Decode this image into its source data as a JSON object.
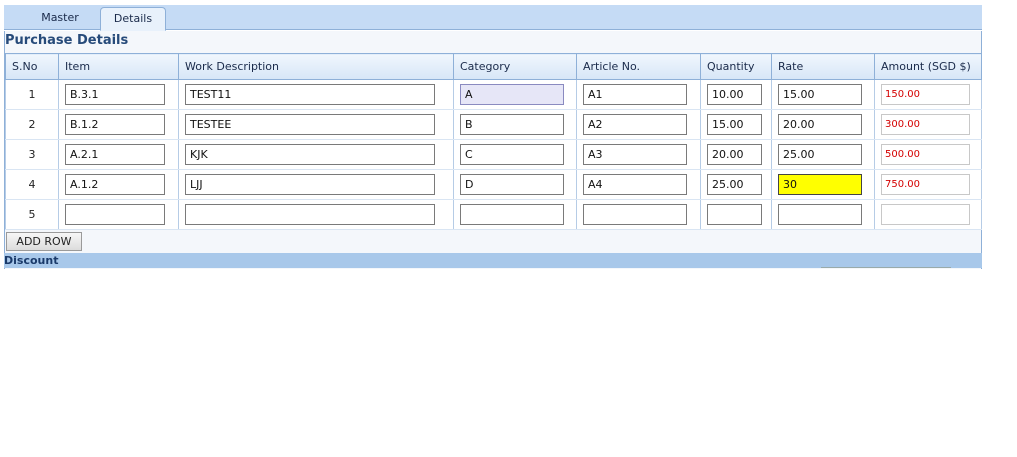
{
  "tabs": [
    {
      "label": "Master"
    },
    {
      "label": "Details"
    }
  ],
  "panel": {
    "title": "Purchase Details"
  },
  "table": {
    "columns": [
      "S.No",
      "Item",
      "Work Description",
      "Category",
      "Article No.",
      "Quantity",
      "Rate",
      "Amount (SGD $)"
    ],
    "rows": [
      {
        "sno": "1",
        "item": "B.3.1",
        "desc": "TEST11",
        "category": "A",
        "article": "A1",
        "quantity": "10.00",
        "rate": "15.00",
        "amount": "150.00"
      },
      {
        "sno": "2",
        "item": "B.1.2",
        "desc": "TESTEE",
        "category": "B",
        "article": "A2",
        "quantity": "15.00",
        "rate": "20.00",
        "amount": "300.00"
      },
      {
        "sno": "3",
        "item": "A.2.1",
        "desc": "KJK",
        "category": "C",
        "article": "A3",
        "quantity": "20.00",
        "rate": "25.00",
        "amount": "500.00"
      },
      {
        "sno": "4",
        "item": "A.1.2",
        "desc": "LJJ",
        "category": "D",
        "article": "A4",
        "quantity": "25.00",
        "rate": "30",
        "amount": "750.00"
      },
      {
        "sno": "5",
        "item": "",
        "desc": "",
        "category": "",
        "article": "",
        "quantity": "",
        "rate": "",
        "amount": ""
      }
    ]
  },
  "buttons": {
    "add_row": "ADD ROW"
  },
  "discount": {
    "label": "Discount"
  },
  "colors": {
    "header_bg": "#c5dbf5",
    "section_title": "#274b7a",
    "amount_text": "#d40000",
    "focused_rate_bg": "#ffff00",
    "focused_category_bg": "#e6e6f7"
  }
}
